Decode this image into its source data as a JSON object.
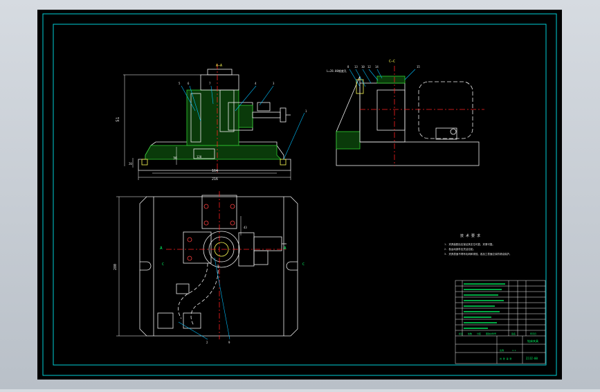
{
  "colors": {
    "frame": "#00d0d8",
    "outline": "#f0f0f0",
    "centerline": "#ff2020",
    "hatch": "#30d030",
    "dimension": "#ffffff",
    "leader": "#00c0ff",
    "text_yellow": "#ffff55",
    "background": "#000000"
  },
  "front_view": {
    "section_label": "A—A",
    "dim_height": "51",
    "dim_inner": "36",
    "dim_width_inner": "164",
    "dim_width_total": "216",
    "dim_base_small": "20",
    "dim_base_center": "120",
    "leaders": [
      "5",
      "6",
      "7",
      "4",
      "3",
      "1"
    ]
  },
  "side_view": {
    "section_label": "C—C",
    "note_label": "L=28.00锥度孔",
    "leaders": [
      "8",
      "13",
      "10",
      "12",
      "14",
      "15"
    ]
  },
  "plan_view": {
    "dim_height": "280",
    "dim_offset": "43",
    "section_marks": [
      "A",
      "A",
      "C",
      "C"
    ],
    "leaders": [
      "2",
      "9"
    ]
  },
  "tech_requirements": {
    "title": "技 术 要 求",
    "items": [
      "1. 夹具装配后应保证其定位可靠、夹紧可靠。",
      "2. 各运动部件应灵活自如。",
      "3. 夹具表面不得有毛刺和锈蚀，各加工表面应涂防锈油保护。"
    ]
  },
  "title_block": {
    "drawing_name": "钻床夹具",
    "drawing_number": "ZJJZ-00",
    "footer_labels": [
      "标记",
      "处数",
      "分区",
      "更改文件号",
      "签名",
      "年月日"
    ],
    "scale_label": "比例",
    "scale_value": "1:1",
    "sheet_label": "共 张 第 张"
  }
}
